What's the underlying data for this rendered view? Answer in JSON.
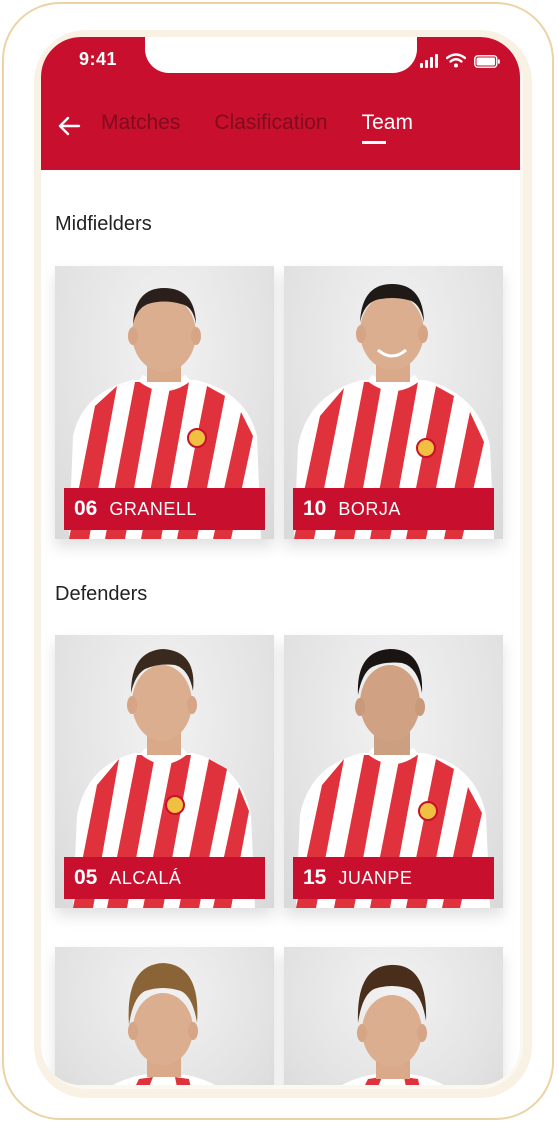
{
  "status": {
    "time": "9:41"
  },
  "nav": {
    "tabs": [
      {
        "label": "Matches",
        "active": false
      },
      {
        "label": "Clasification",
        "active": false
      },
      {
        "label": "Team",
        "active": true
      }
    ]
  },
  "sections": [
    {
      "title": "Midfielders",
      "players": [
        {
          "number": "06",
          "name": "GRANELL"
        },
        {
          "number": "10",
          "name": "BORJA"
        }
      ]
    },
    {
      "title": "Defenders",
      "players": [
        {
          "number": "05",
          "name": "ALCALÁ"
        },
        {
          "number": "15",
          "name": "JUANPE"
        }
      ]
    },
    {
      "title": "",
      "players": [
        {
          "number": "",
          "name": ""
        },
        {
          "number": "",
          "name": ""
        }
      ]
    }
  ],
  "colors": {
    "accent": "#c8102e",
    "inactive_tab": "#7f0b1d",
    "jersey_white": "#ffffff",
    "jersey_red": "#e0323c"
  }
}
